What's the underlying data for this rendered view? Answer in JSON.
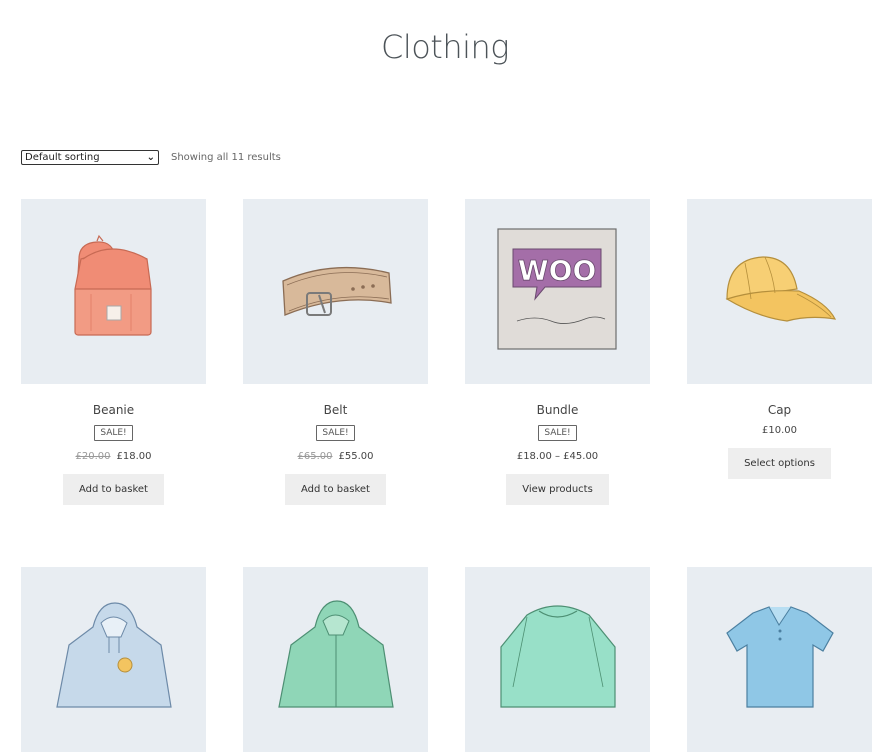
{
  "page": {
    "title": "Clothing"
  },
  "toolbar": {
    "sort_selected": "Default sorting",
    "result_count": "Showing all 11 results"
  },
  "products": [
    {
      "name": "Beanie",
      "sale": "SALE!",
      "old_price": "£20.00",
      "price": "£18.00",
      "button": "Add to basket",
      "image": "beanie-image"
    },
    {
      "name": "Belt",
      "sale": "SALE!",
      "old_price": "£65.00",
      "price": "£55.00",
      "button": "Add to basket",
      "image": "belt-image"
    },
    {
      "name": "Bundle",
      "sale": "SALE!",
      "old_price": "",
      "price": "£18.00 – £45.00",
      "button": "View products",
      "image": "woo-album-image"
    },
    {
      "name": "Cap",
      "sale": "",
      "old_price": "",
      "price": "£10.00",
      "button": "Select options",
      "image": "cap-image"
    }
  ],
  "second_row_images": [
    "hoodie-with-logo-image",
    "hoodie-image",
    "sweater-image",
    "polo-image"
  ],
  "colors": {
    "thumb_bg": "#e8edf2",
    "button_bg": "#eeeeee",
    "title": "#4c5358"
  }
}
